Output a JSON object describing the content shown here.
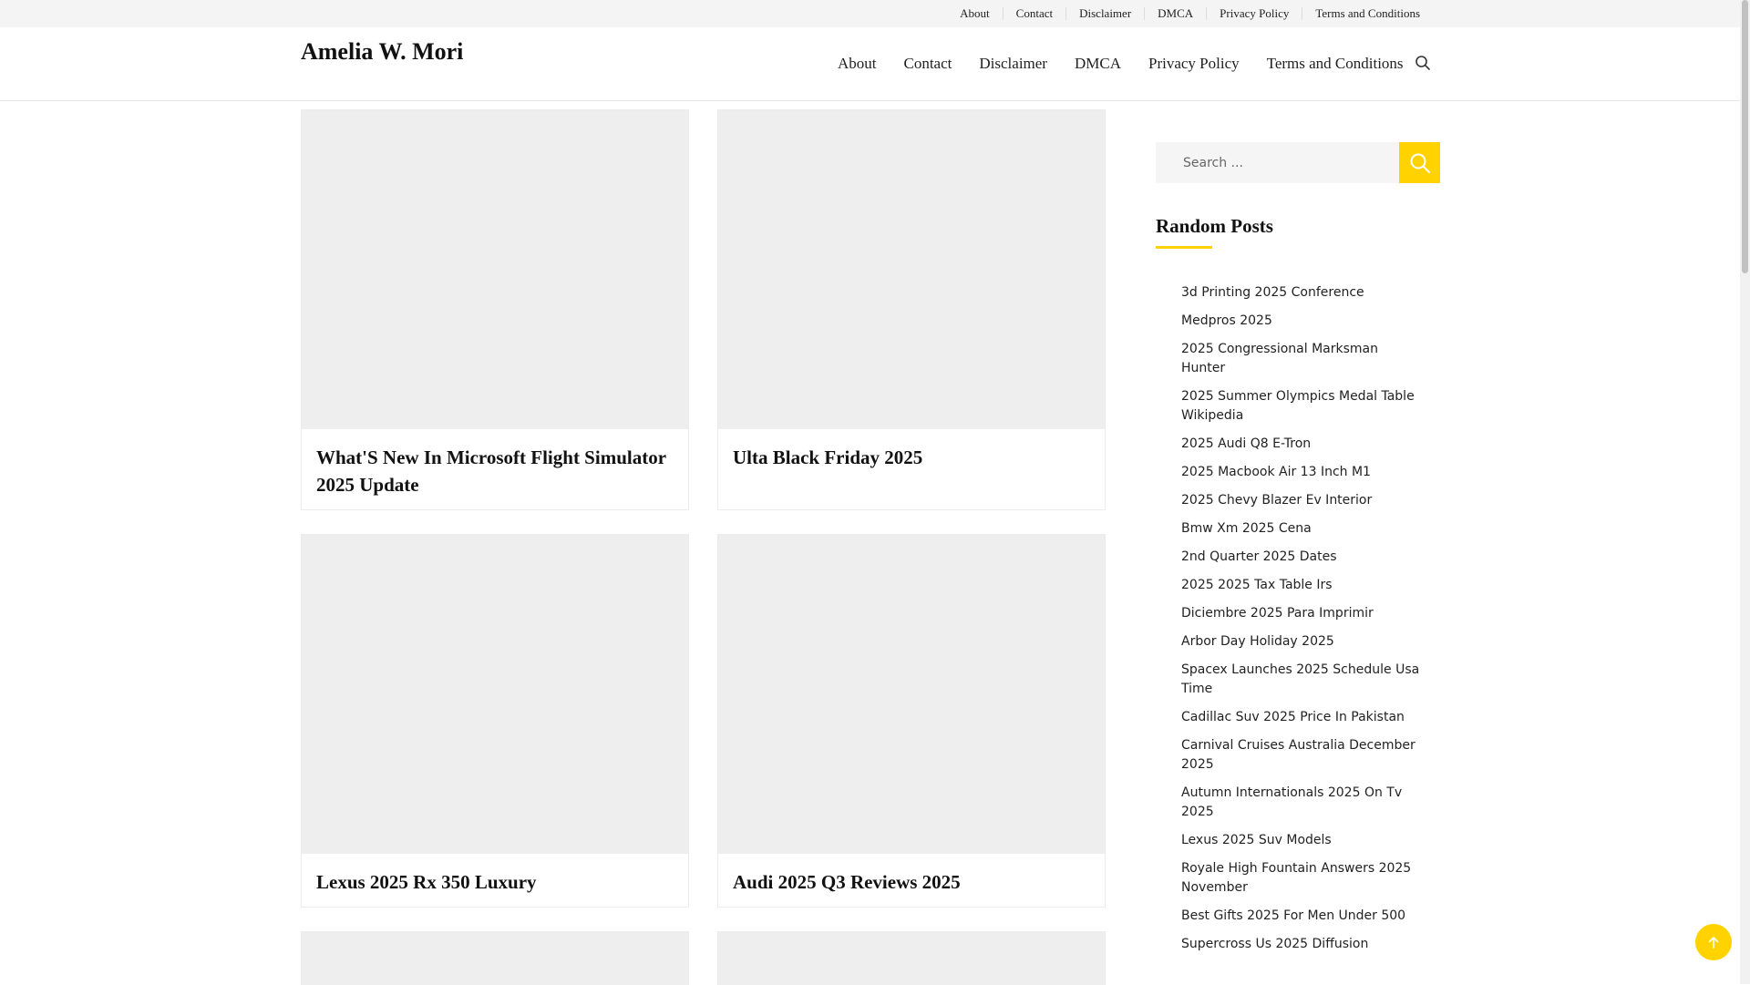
{
  "topbar": {
    "links": [
      "About",
      "Contact",
      "Disclaimer",
      "DMCA",
      "Privacy Policy",
      "Terms and Conditions"
    ]
  },
  "header": {
    "site_title": "Amelia W. Mori",
    "nav": [
      "About",
      "Contact",
      "Disclaimer",
      "DMCA",
      "Privacy Policy",
      "Terms and Conditions"
    ],
    "search_icon": "search-icon"
  },
  "posts": [
    {
      "title": "What'S New In Microsoft Flight Simulator 2025 Update"
    },
    {
      "title": "Ulta Black Friday 2025"
    },
    {
      "title": "Lexus 2025 Rx 350 Luxury"
    },
    {
      "title": "Audi 2025 Q3 Reviews 2025"
    },
    {
      "title": ""
    },
    {
      "title": ""
    }
  ],
  "sidebar": {
    "search": {
      "placeholder": "Search ...",
      "button_icon": "search-icon"
    },
    "random_posts_title": "Random Posts",
    "random_posts": [
      "3d Printing 2025 Conference",
      "Medpros 2025",
      "2025 Congressional Marksman Hunter",
      "2025 Summer Olympics Medal Table Wikipedia",
      "2025 Audi Q8 E-Tron",
      "2025 Macbook Air 13 Inch M1",
      "2025 Chevy Blazer Ev Interior",
      "Bmw Xm 2025 Cena",
      "2nd Quarter 2025 Dates",
      "2025 2025 Tax Table Irs",
      "Diciembre 2025 Para Imprimir",
      "Arbor Day Holiday 2025",
      "Spacex Launches 2025 Schedule Usa Time",
      "Cadillac Suv 2025 Price In Pakistan",
      "Carnival Cruises Australia December 2025",
      "Autumn Internationals 2025 On Tv 2025",
      "Lexus 2025 Suv Models",
      "Royale High Fountain Answers 2025 November",
      "Best Gifts 2025 For Men Under 500",
      "Supercross Us 2025 Diffusion"
    ]
  },
  "colors": {
    "accent": "#ffd200",
    "thumb_bg": "#eeeeee",
    "topbar_bg": "#f4f4f4"
  },
  "back_to_top_icon": "arrow-up-icon"
}
